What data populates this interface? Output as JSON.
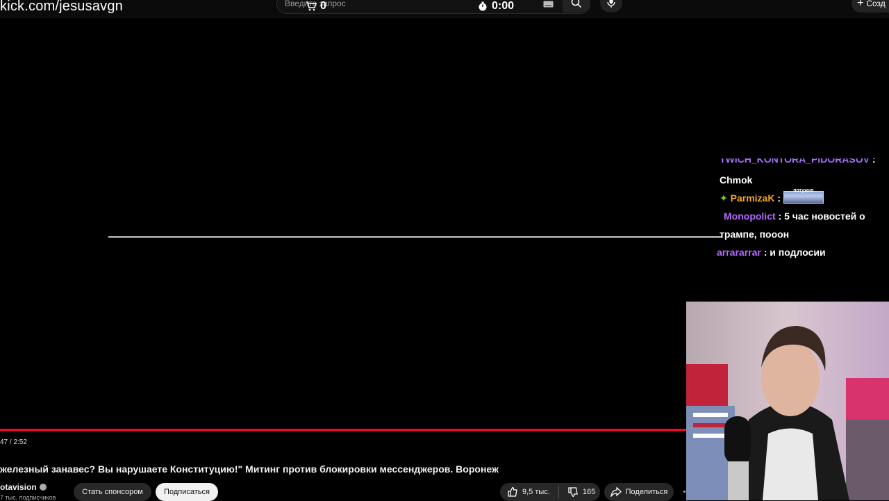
{
  "overlay": {
    "url": "kick.com/jesusavgn"
  },
  "topbar": {
    "search_placeholder": "Введите запрос",
    "cart_count": "0",
    "timer": "0:00",
    "create_label": "Созд"
  },
  "player": {
    "time": "47 / 2:52",
    "progress_fraction": 1.0
  },
  "chat": {
    "messages": [
      {
        "user": "TWICH_KONTORA_PIDORASOV",
        "text": "Chmok",
        "user_color": "#a970ff"
      },
      {
        "user": "ParmizaK",
        "text": "",
        "emote_text": "потужно",
        "user_color": "#f5a623",
        "badge": "star"
      },
      {
        "user": "Monopolict",
        "text": "5 час новостей о трампе, пооон",
        "user_color": "#b36bff"
      },
      {
        "user": "arrararrar",
        "text": "и подлосии",
        "user_color": "#b36bff"
      }
    ]
  },
  "video": {
    "title": "железный занавес? Вы нарушаете Конституцию!\" Митинг против блокировки мессенджеров. Воронеж",
    "channel": "otavision",
    "subscribers": "7 тыс. подписчиков",
    "sponsor_label": "Стать спонсором",
    "subscribe_label": "Подписаться",
    "likes": "9,5 тыс.",
    "dislikes": "165",
    "share_label": "Поделиться"
  },
  "colors": {
    "progress": "#ff0033",
    "accent_purple": "#a970ff"
  }
}
